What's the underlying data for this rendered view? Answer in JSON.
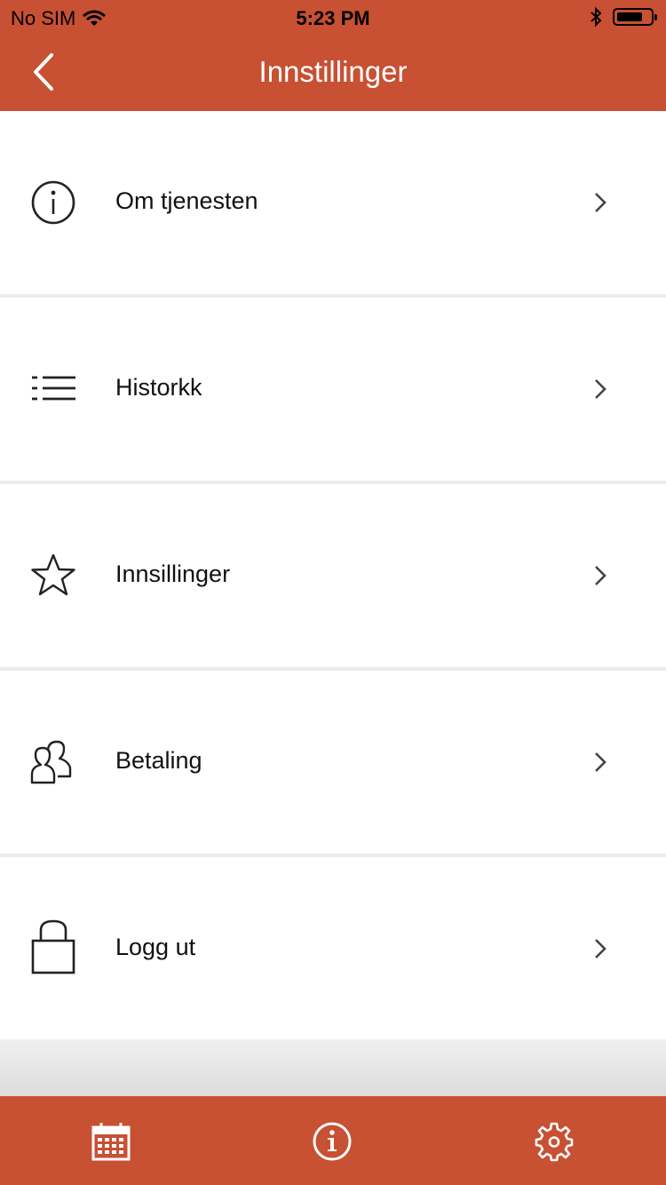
{
  "status_bar": {
    "carrier": "No SIM",
    "time": "5:23 PM"
  },
  "header": {
    "title": "Innstillinger",
    "color": "#c85033"
  },
  "menu": {
    "items": [
      {
        "label": "Om tjenesten",
        "icon": "info-circle-icon"
      },
      {
        "label": "Historkk",
        "icon": "list-icon"
      },
      {
        "label": "Innsillinger",
        "icon": "star-icon"
      },
      {
        "label": "Betaling",
        "icon": "users-icon"
      },
      {
        "label": "Logg ut",
        "icon": "lock-icon"
      }
    ]
  },
  "tab_bar": {
    "tabs": [
      {
        "name": "calendar",
        "icon": "calendar-icon"
      },
      {
        "name": "info",
        "icon": "info-icon"
      },
      {
        "name": "settings",
        "icon": "gear-icon"
      }
    ]
  }
}
